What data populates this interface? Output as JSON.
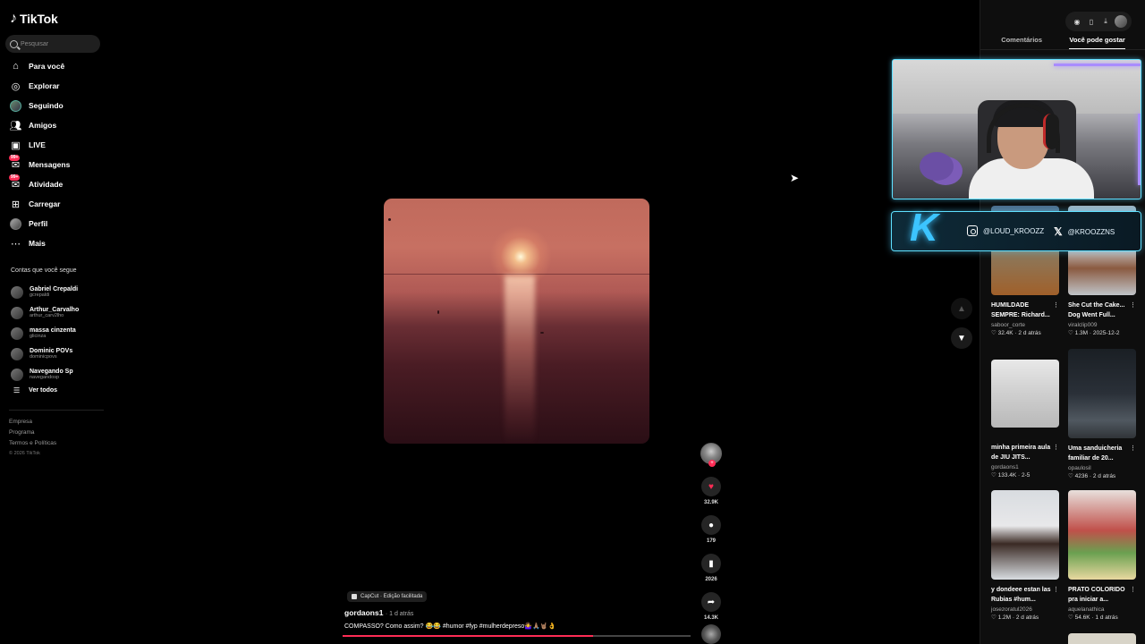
{
  "app": {
    "logo_text": "TikTok",
    "search_placeholder": "Pesquisar"
  },
  "sidebar": {
    "items": [
      {
        "label": "Para você",
        "icon": "home-icon"
      },
      {
        "label": "Explorar",
        "icon": "compass-icon"
      },
      {
        "label": "Seguindo",
        "icon": "following-avatar"
      },
      {
        "label": "Amigos",
        "icon": "friends-icon"
      },
      {
        "label": "LIVE",
        "icon": "live-icon"
      },
      {
        "label": "Mensagens",
        "icon": "messages-icon",
        "badge": "99+"
      },
      {
        "label": "Atividade",
        "icon": "activity-icon",
        "badge": "99+"
      },
      {
        "label": "Carregar",
        "icon": "upload-icon"
      },
      {
        "label": "Perfil",
        "icon": "profile-avatar"
      },
      {
        "label": "Mais",
        "icon": "more-icon"
      }
    ],
    "following_title": "Contas que você segue",
    "following": [
      {
        "name": "Gabriel Crepaldi",
        "handle": "gcrepaldi"
      },
      {
        "name": "Arthur_Carvalho",
        "handle": "arthur_carv2lho"
      },
      {
        "name": "massa cinzenta",
        "handle": "glicinza"
      },
      {
        "name": "Dominic POVs",
        "handle": "dominicpovs"
      },
      {
        "name": "Navegando Sp",
        "handle": "navegandosp"
      }
    ],
    "see_all": "Ver todos",
    "footer": [
      "Empresa",
      "Programa",
      "Termos e Políticas"
    ],
    "copyright": "© 2026 TikTok"
  },
  "video": {
    "capcut_label": "CapCut · Edição facilitada",
    "author": "gordaons1",
    "meta": "· 1 d atrás",
    "description": "COMPASSO? Como assim? 😂😂 #humor #fyp #mulherdepreso🤷‍♀️🙏🏽🤘🏽👌",
    "progress": 0.72
  },
  "actions": {
    "likes": "32.9K",
    "comments": "179",
    "saves": "2026",
    "shares": "14.3K"
  },
  "right_panel": {
    "tabs": [
      "Comentários",
      "Você pode gostar"
    ],
    "active_tab": 1,
    "cards": [
      {
        "title": "HUMILDADE SEMPRE: Richard...",
        "author": "saboor_corte",
        "likes": "32.4K",
        "date": "2 d atrás"
      },
      {
        "title": "She Cut the Cake... Dog Went Full...",
        "author": "viralclip009",
        "likes": "1.3M",
        "date": "2025-12-2"
      },
      {
        "title": "minha primeira aula de JIU JITS...",
        "author": "gordaons1",
        "likes": "133.4K",
        "date": "2-5"
      },
      {
        "title": "Uma sanduicheria familiar de 20...",
        "author": "opaulosil",
        "likes": "4236",
        "date": "2 d atrás"
      },
      {
        "title": "y dondeee estan las Rubias #hum...",
        "author": "josezoratul2026",
        "likes": "1.2M",
        "date": "2 d atrás"
      },
      {
        "title": "PRATO COLORIDO pra iniciar a...",
        "author": "aquelanathica",
        "likes": "54.6K",
        "date": "1 d atrás"
      }
    ]
  },
  "overlay": {
    "instagram": "@LOUD_KROOZZ",
    "x_handle": "@KROOZZNS",
    "accent": "#5fe0ff"
  },
  "colors": {
    "brand": "#fe2c55",
    "background": "#000000"
  }
}
